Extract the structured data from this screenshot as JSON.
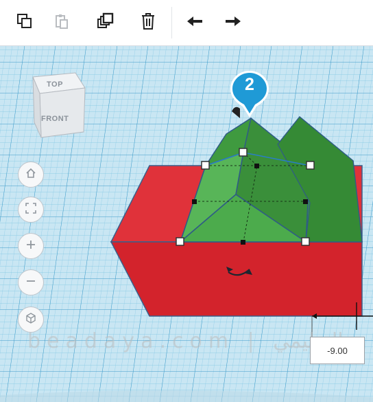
{
  "toolbar": {
    "buttons": [
      {
        "name": "copy",
        "icon": "copy-icon"
      },
      {
        "name": "paste",
        "icon": "paste-icon"
      },
      {
        "name": "duplicate",
        "icon": "duplicate-icon"
      },
      {
        "name": "delete",
        "icon": "trash-icon"
      },
      {
        "name": "undo",
        "icon": "undo-arrow-icon"
      },
      {
        "name": "redo",
        "icon": "redo-arrow-icon"
      }
    ]
  },
  "viewcube": {
    "top_label": "TOP",
    "front_label": "FRONT"
  },
  "nav": [
    {
      "name": "home",
      "icon": "home-icon"
    },
    {
      "name": "fit",
      "icon": "fit-view-icon"
    },
    {
      "name": "zoom-in",
      "icon": "plus-icon"
    },
    {
      "name": "zoom-out",
      "icon": "minus-icon"
    },
    {
      "name": "ortho",
      "icon": "perspective-cube-icon"
    }
  ],
  "step_badge": "2",
  "dimension": "-9.00",
  "watermark": "beadaya.com | التعليمي",
  "colors": {
    "grid_background": "#c9e6f3",
    "grid_line": "#4aa8d4",
    "red_box": "#d8262e",
    "green_roof": "#3f9b3f",
    "badge": "#1f9ad6"
  }
}
